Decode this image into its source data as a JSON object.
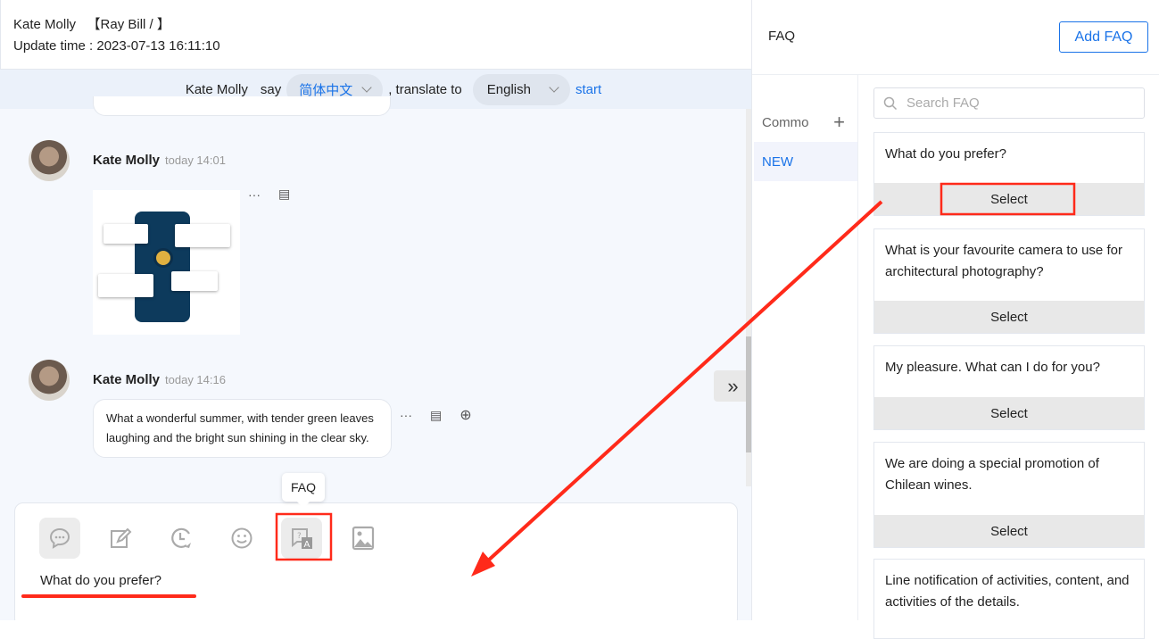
{
  "header": {
    "contact": "Kate Molly",
    "agent": "【Ray Bill / 】",
    "update_time": "Update time : 2023-07-13 16:11:10"
  },
  "translate_bar": {
    "speaker": "Kate Molly",
    "say": "say",
    "source_lang": "简体中文",
    "translate_to": ", translate to",
    "target_lang": "English",
    "start": "start"
  },
  "messages": [
    {
      "sender": "Kate Molly",
      "time": "today 14:01",
      "type": "image"
    },
    {
      "sender": "Kate Molly",
      "time": "today 14:16",
      "type": "text",
      "text": "What a wonderful summer, with tender green leaves laughing and the bright sun shining in the clear sky."
    }
  ],
  "composer": {
    "tooltip": "FAQ",
    "text": "What do you prefer?",
    "tools": [
      "chat-bubble",
      "edit",
      "history",
      "emoji",
      "faq",
      "image"
    ]
  },
  "faq_panel": {
    "title": "FAQ",
    "add_button": "Add FAQ",
    "search_placeholder": "Search FAQ",
    "categories": [
      {
        "label": "Commo",
        "active": false
      },
      {
        "label": "NEW",
        "active": true
      }
    ],
    "items": [
      {
        "question": "What do you prefer?",
        "select": "Select"
      },
      {
        "question": "What is your favourite camera to use for architectural photography?",
        "select": "Select"
      },
      {
        "question": "My pleasure. What can I do for you?",
        "select": "Select"
      },
      {
        "question": "We are doing a special promotion of Chilean wines.",
        "select": "Select"
      },
      {
        "question": "Line notification of activities, content, and activities of the details.",
        "select": ""
      }
    ]
  },
  "colors": {
    "accent": "#1a73e8",
    "annotation": "#ff2a1a"
  }
}
